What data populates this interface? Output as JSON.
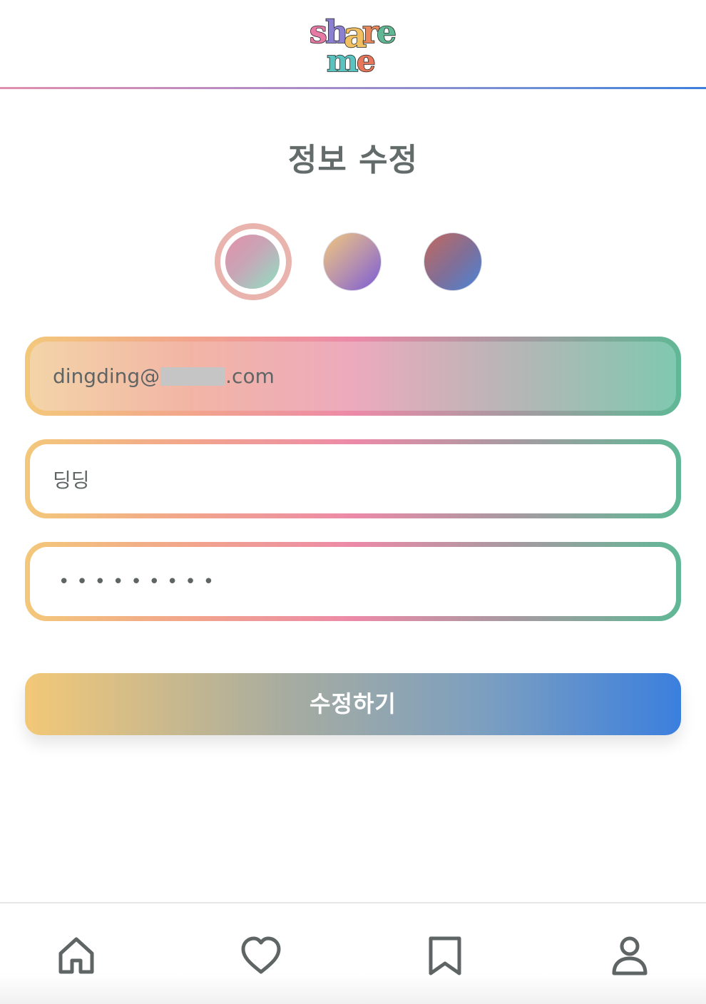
{
  "header": {
    "logo_icon": "share-me-logo"
  },
  "page": {
    "title": "정보 수정"
  },
  "colors": {
    "options": [
      {
        "name": "pink-mint",
        "from": "#e58fa8",
        "to": "#8fe0c2",
        "selected": true
      },
      {
        "name": "gold-violet",
        "from": "#f1c77d",
        "to": "#7a5bd6",
        "selected": false
      },
      {
        "name": "brick-blue",
        "from": "#c4685c",
        "to": "#4a86d8",
        "selected": false
      }
    ],
    "accent_blue": "#3d7fdc",
    "text_gray": "#636b6b"
  },
  "form": {
    "email": {
      "prefix": "dingding@",
      "suffix": ".com"
    },
    "nickname": {
      "value": "딩딩"
    },
    "password": {
      "masked": "•••••••••"
    },
    "submit_label": "수정하기"
  },
  "bottom_nav": {
    "items": [
      {
        "icon": "home-icon"
      },
      {
        "icon": "heart-icon"
      },
      {
        "icon": "bookmark-icon"
      },
      {
        "icon": "user-icon"
      }
    ]
  }
}
